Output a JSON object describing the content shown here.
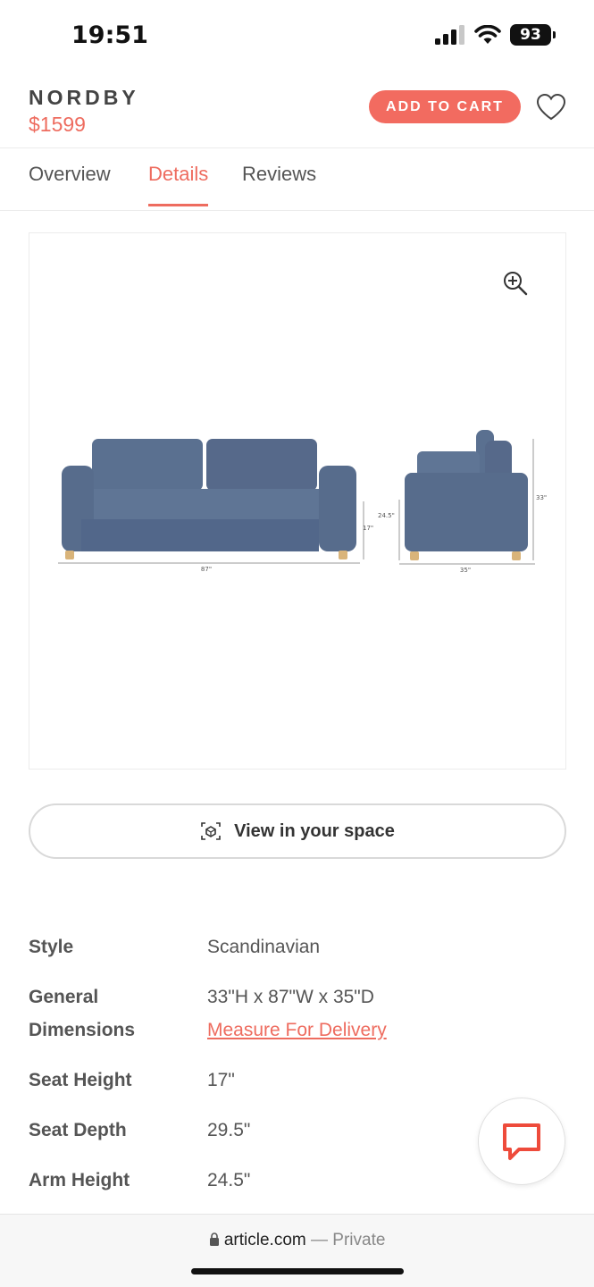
{
  "status_bar": {
    "time": "19:51",
    "battery": "93"
  },
  "product": {
    "name": "NORDBY",
    "price": "$1599",
    "add_to_cart_label": "ADD TO CART"
  },
  "tabs": [
    {
      "label": "Overview"
    },
    {
      "label": "Details",
      "active": true
    },
    {
      "label": "Reviews"
    }
  ],
  "diagram": {
    "front_width": "87\"",
    "front_seat_height": "17\"",
    "side_arm_height": "24.5\"",
    "side_height": "33\"",
    "side_depth": "35\""
  },
  "view_in_space": {
    "label": "View in your space"
  },
  "specs": {
    "style": {
      "label": "Style",
      "value": "Scandinavian"
    },
    "general_dimensions": {
      "label_line1": "General",
      "label_line2": "Dimensions",
      "value": "33\"H x 87\"W x 35\"D",
      "link": "Measure For Delivery"
    },
    "seat_height": {
      "label": "Seat Height",
      "value": "17\""
    },
    "seat_depth": {
      "label": "Seat Depth",
      "value": "29.5\""
    },
    "arm_height": {
      "label": "Arm Height",
      "value": "24.5\""
    }
  },
  "browser": {
    "domain": "article.com",
    "separator": "—",
    "private": "Private"
  },
  "colors": {
    "accent": "#ee6c5f",
    "sofa": "#5a7090"
  },
  "icons": [
    "signal-icon",
    "wifi-icon",
    "battery-icon",
    "heart-icon",
    "zoom-in-icon",
    "ar-cube-icon",
    "chat-icon",
    "lock-icon"
  ]
}
